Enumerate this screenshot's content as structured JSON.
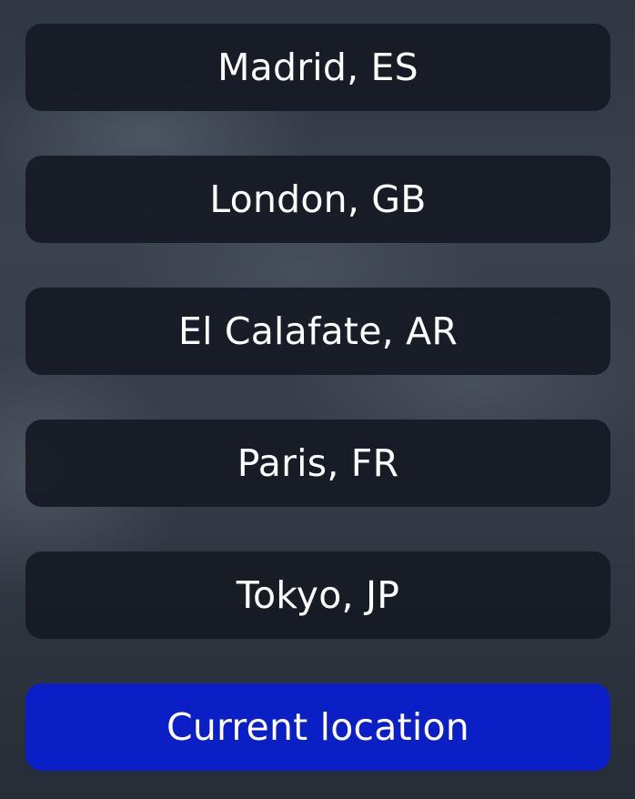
{
  "locations": [
    {
      "label": "Madrid, ES"
    },
    {
      "label": "London, GB"
    },
    {
      "label": "El Calafate, AR"
    },
    {
      "label": "Paris, FR"
    },
    {
      "label": "Tokyo, JP"
    }
  ],
  "current_location": {
    "label": "Current location"
  },
  "colors": {
    "button_background": "#161a23",
    "primary_button": "#0a1fc6",
    "text": "#ffffff"
  }
}
